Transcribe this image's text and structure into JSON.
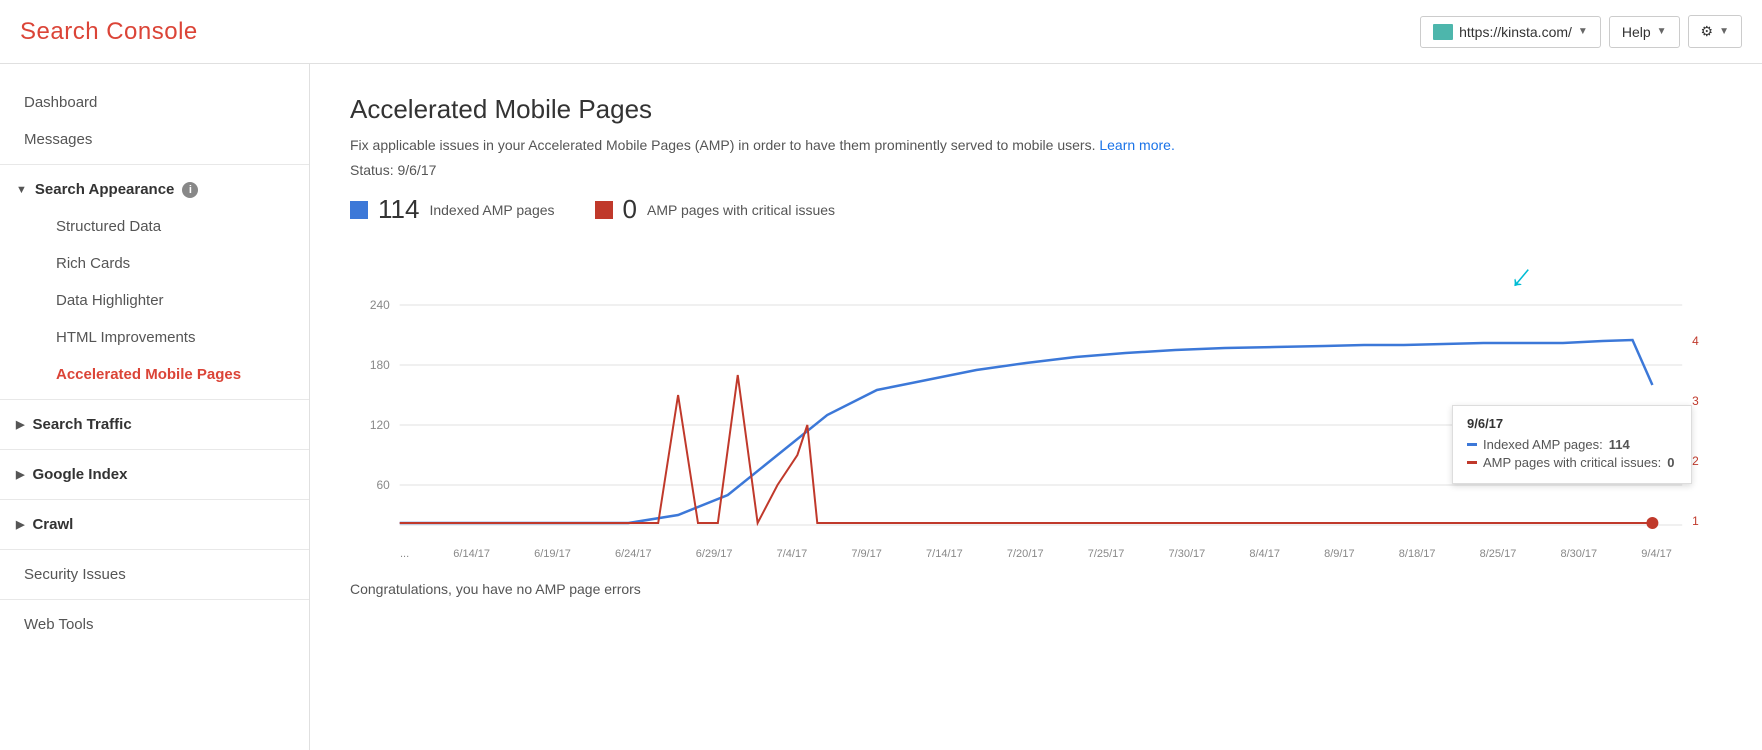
{
  "header": {
    "title": "Search Console",
    "site_url": "https://kinsta.com/",
    "help_label": "Help",
    "settings_label": "Settings"
  },
  "sidebar": {
    "items": [
      {
        "id": "dashboard",
        "label": "Dashboard",
        "level": 0,
        "active": false
      },
      {
        "id": "messages",
        "label": "Messages",
        "level": 0,
        "active": false
      },
      {
        "id": "search-appearance",
        "label": "Search Appearance",
        "level": 0,
        "section": true,
        "expanded": true
      },
      {
        "id": "structured-data",
        "label": "Structured Data",
        "level": 1,
        "active": false
      },
      {
        "id": "rich-cards",
        "label": "Rich Cards",
        "level": 1,
        "active": false
      },
      {
        "id": "data-highlighter",
        "label": "Data Highlighter",
        "level": 1,
        "active": false
      },
      {
        "id": "html-improvements",
        "label": "HTML Improvements",
        "level": 1,
        "active": false
      },
      {
        "id": "amp",
        "label": "Accelerated Mobile Pages",
        "level": 1,
        "active": true
      },
      {
        "id": "search-traffic",
        "label": "Search Traffic",
        "level": 0,
        "section": true,
        "expanded": false
      },
      {
        "id": "google-index",
        "label": "Google Index",
        "level": 0,
        "section": true,
        "expanded": false
      },
      {
        "id": "crawl",
        "label": "Crawl",
        "level": 0,
        "section": true,
        "expanded": false
      },
      {
        "id": "security-issues",
        "label": "Security Issues",
        "level": 0,
        "active": false
      },
      {
        "id": "web-tools",
        "label": "Web Tools",
        "level": 0,
        "active": false
      }
    ]
  },
  "main": {
    "page_title": "Accelerated Mobile Pages",
    "description": "Fix applicable issues in your Accelerated Mobile Pages (AMP) in order to have them prominently served to mobile users.",
    "learn_more": "Learn more.",
    "status_label": "Status: 9/6/17",
    "indexed_count": "114",
    "indexed_label": "Indexed AMP pages",
    "critical_count": "0",
    "critical_label": "AMP pages with critical issues",
    "congrats": "Congratulations, you have no AMP page errors",
    "tooltip": {
      "date": "9/6/17",
      "row1_label": "Indexed AMP pages:",
      "row1_value": "114",
      "row2_label": "AMP pages with critical issues:",
      "row2_value": "0"
    },
    "x_axis_labels": [
      "...",
      "6/14/17",
      "6/19/17",
      "6/24/17",
      "6/29/17",
      "7/4/17",
      "7/9/17",
      "7/14/17",
      "7/20/17",
      "7/25/17",
      "7/30/17",
      "8/4/17",
      "8/9/17",
      "8/18/17",
      "8/25/17",
      "8/30/17",
      "9/4/17"
    ],
    "y_axis_labels": [
      "60",
      "120",
      "180",
      "240"
    ],
    "y_axis_right": [
      "1",
      "2",
      "3",
      "4"
    ],
    "colors": {
      "blue": "#3c78d8",
      "red": "#c0392b",
      "teal": "#00bcd4"
    }
  }
}
